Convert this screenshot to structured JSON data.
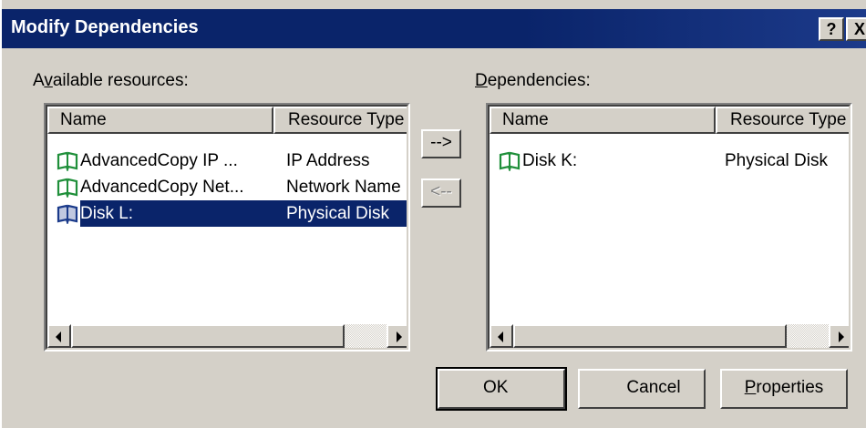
{
  "window": {
    "title": "Modify Dependencies",
    "help_label": "?",
    "close_label": "X"
  },
  "available": {
    "label": "Available resources:",
    "label_before": "A",
    "label_mnemonic": "v",
    "label_after": "ailable resources:",
    "columns": [
      "Name",
      "Resource Type"
    ],
    "rows": [
      {
        "name": "AdvancedCopy IP ...",
        "type": "IP Address",
        "icon": "resource-book-icon",
        "selected": false
      },
      {
        "name": "AdvancedCopy Net...",
        "type": "Network Name",
        "icon": "resource-book-icon",
        "selected": false
      },
      {
        "name": "Disk L:",
        "type": "Physical Disk",
        "icon": "resource-book-icon",
        "selected": true
      }
    ]
  },
  "dependencies": {
    "label": "Dependencies:",
    "label_mnemonic": "D",
    "label_after": "ependencies:",
    "columns": [
      "Name",
      "Resource Type"
    ],
    "rows": [
      {
        "name": "Disk K:",
        "type": "Physical Disk",
        "icon": "resource-book-icon",
        "selected": false
      }
    ]
  },
  "move": {
    "add_label": "-->",
    "remove_label": "<--",
    "remove_enabled": false
  },
  "buttons": {
    "ok_label": "OK",
    "cancel_label": "Cancel",
    "properties_label": "Properties",
    "properties_mnemonic": "P",
    "properties_after": "roperties"
  },
  "colors": {
    "titlebar": "#0a246a",
    "face": "#d4d0c8",
    "selection": "#0a246a",
    "icon_green": "#1f8f3a",
    "icon_blue": "#1a3a8a"
  }
}
